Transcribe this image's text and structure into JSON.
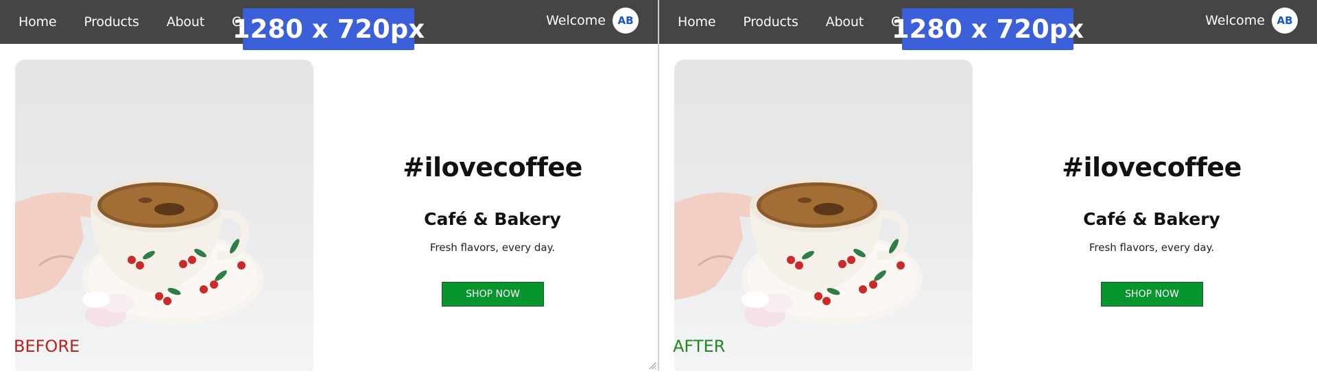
{
  "nav": {
    "links": [
      "Home",
      "Products",
      "About",
      "Contact"
    ],
    "welcome": "Welcome",
    "avatar_initials": "AB"
  },
  "badge": {
    "dimensions": "1280 x 720px"
  },
  "hero": {
    "hashtag": "#ilovecoffee",
    "subtitle": "Café & Bakery",
    "tagline": "Fresh flavors, every day.",
    "button_label": "SHOP NOW"
  },
  "panels": {
    "before_label": "BEFORE",
    "after_label": "AFTER"
  },
  "colors": {
    "navbar_bg": "#454545",
    "badge_bg": "#3b5fd9",
    "button_bg": "#06962d",
    "before_label": "#b3261e",
    "after_label": "#1e8a1e"
  },
  "icons": [
    "coffee-cup-image",
    "resize-grip-icon"
  ]
}
